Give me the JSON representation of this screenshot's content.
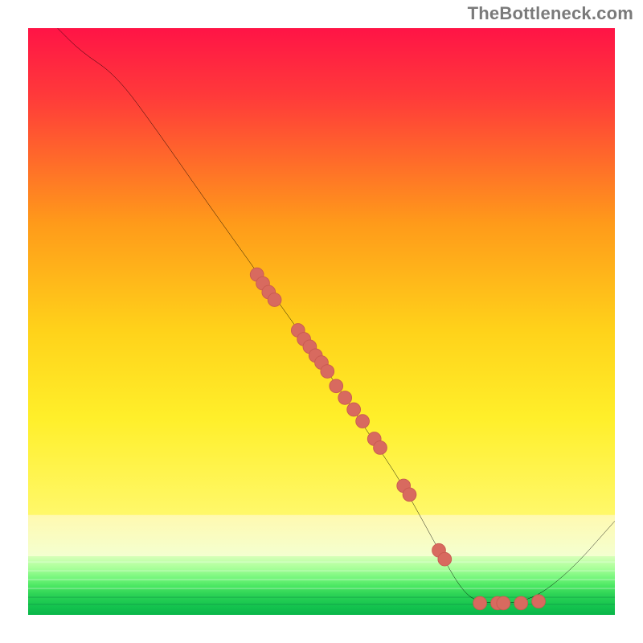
{
  "watermark": "TheBottleneck.com",
  "colors": {
    "curve": "#000000",
    "dot_fill": "#d86a5f",
    "dot_stroke": "#c85a50"
  },
  "chart_data": {
    "type": "line",
    "title": "",
    "xlabel": "",
    "ylabel": "",
    "xlim": [
      0,
      100
    ],
    "ylim": [
      0,
      100
    ],
    "curve": [
      {
        "x": 5,
        "y": 100
      },
      {
        "x": 9,
        "y": 96
      },
      {
        "x": 15,
        "y": 92
      },
      {
        "x": 22,
        "y": 82.5
      },
      {
        "x": 30,
        "y": 71
      },
      {
        "x": 40,
        "y": 57
      },
      {
        "x": 50,
        "y": 43
      },
      {
        "x": 58,
        "y": 31
      },
      {
        "x": 64,
        "y": 22
      },
      {
        "x": 70,
        "y": 11
      },
      {
        "x": 74,
        "y": 4
      },
      {
        "x": 77,
        "y": 2
      },
      {
        "x": 85,
        "y": 2
      },
      {
        "x": 92,
        "y": 7
      },
      {
        "x": 100,
        "y": 16
      }
    ],
    "scatter_points": [
      {
        "x": 39,
        "y": 58
      },
      {
        "x": 40,
        "y": 56.5
      },
      {
        "x": 41,
        "y": 55
      },
      {
        "x": 42,
        "y": 53.7
      },
      {
        "x": 46,
        "y": 48.5
      },
      {
        "x": 47,
        "y": 47
      },
      {
        "x": 48,
        "y": 45.7
      },
      {
        "x": 49,
        "y": 44.2
      },
      {
        "x": 50,
        "y": 43
      },
      {
        "x": 51,
        "y": 41.5
      },
      {
        "x": 52.5,
        "y": 39
      },
      {
        "x": 54,
        "y": 37
      },
      {
        "x": 55.5,
        "y": 35
      },
      {
        "x": 57,
        "y": 33
      },
      {
        "x": 59,
        "y": 30
      },
      {
        "x": 60,
        "y": 28.5
      },
      {
        "x": 64,
        "y": 22
      },
      {
        "x": 65,
        "y": 20.5
      },
      {
        "x": 70,
        "y": 11
      },
      {
        "x": 71,
        "y": 9.5
      },
      {
        "x": 77,
        "y": 2
      },
      {
        "x": 80,
        "y": 2
      },
      {
        "x": 81,
        "y": 2
      },
      {
        "x": 84,
        "y": 2
      },
      {
        "x": 87,
        "y": 2.3
      }
    ]
  }
}
